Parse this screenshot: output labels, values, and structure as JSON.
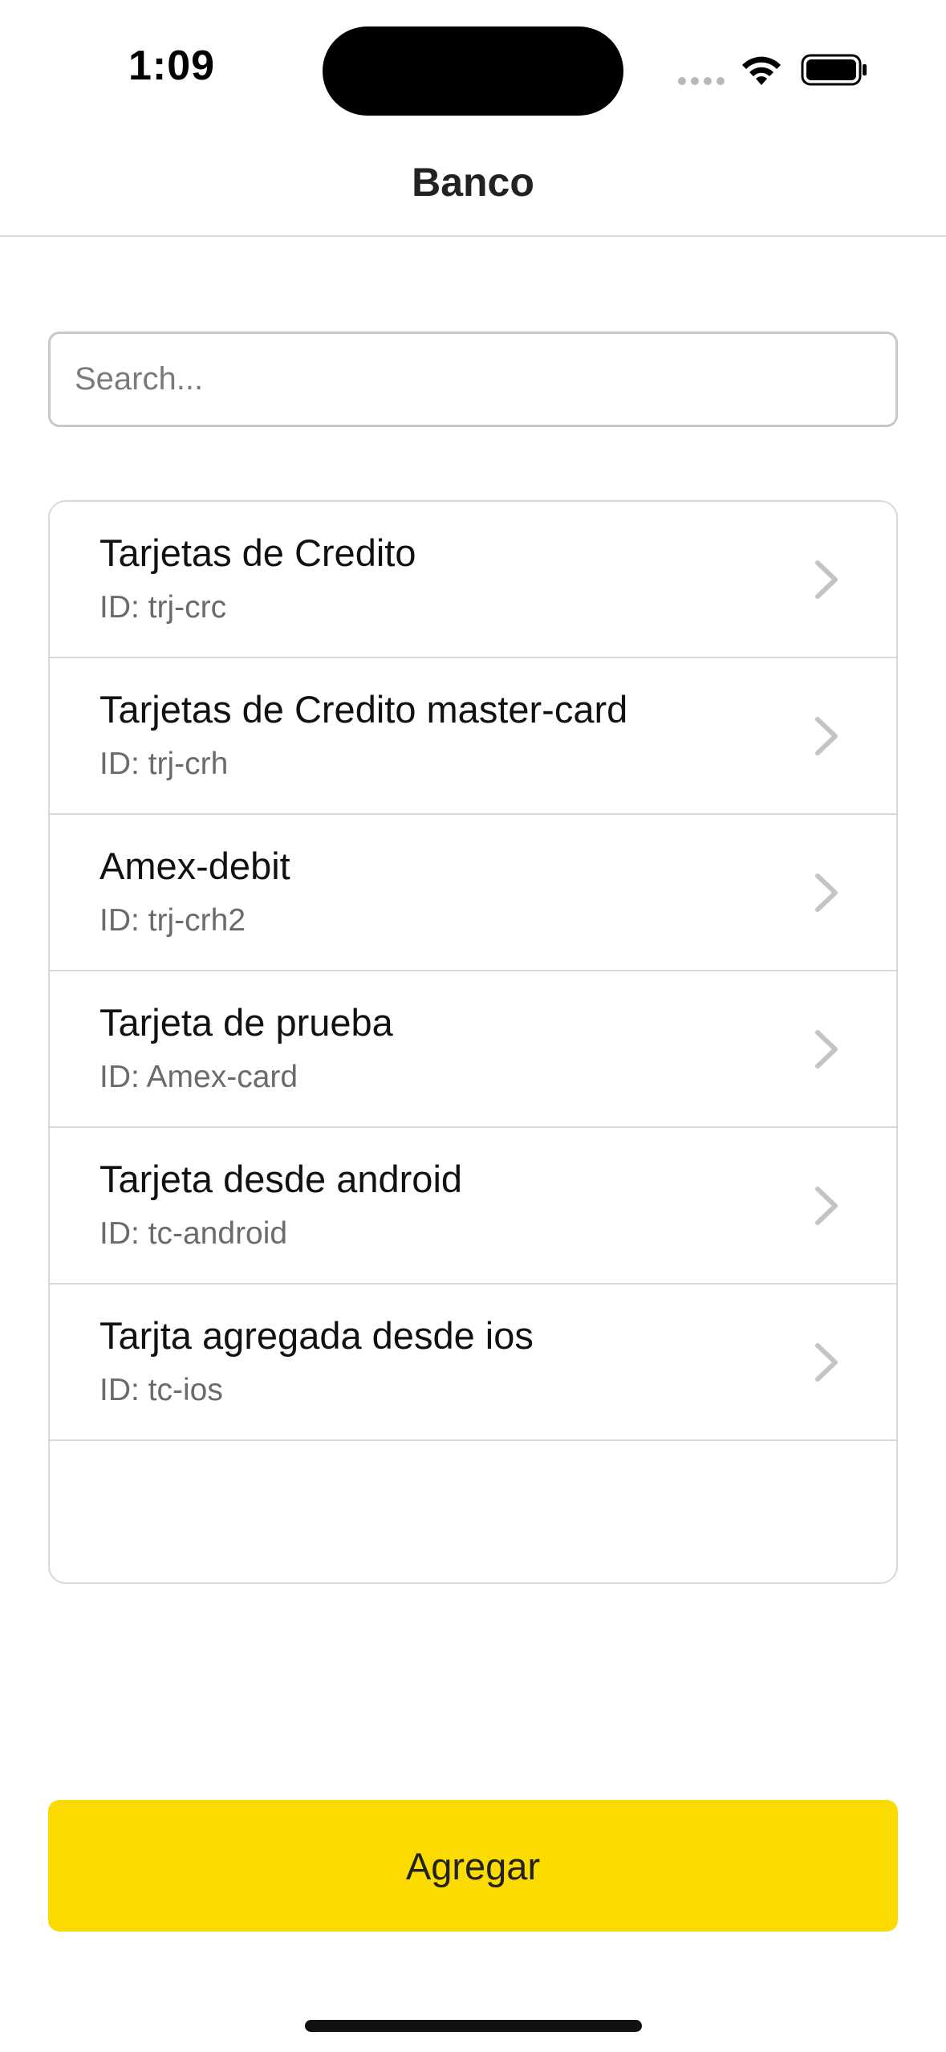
{
  "status_bar": {
    "time": "1:09",
    "icons": [
      "signal-dots-icon",
      "wifi-icon",
      "battery-icon"
    ]
  },
  "header": {
    "title": "Banco"
  },
  "search": {
    "placeholder": "Search...",
    "value": ""
  },
  "list": {
    "items": [
      {
        "title": "Tarjetas de Credito",
        "id": "ID: trj-crc"
      },
      {
        "title": "Tarjetas de Credito master-card",
        "id": "ID: trj-crh"
      },
      {
        "title": "Amex-debit",
        "id": "ID: trj-crh2"
      },
      {
        "title": "Tarjeta de prueba",
        "id": "ID: Amex-card"
      },
      {
        "title": "Tarjeta desde android",
        "id": "ID: tc-android"
      },
      {
        "title": "Tarjta agregada desde ios",
        "id": "ID: tc-ios"
      }
    ]
  },
  "actions": {
    "add_label": "Agregar"
  },
  "colors": {
    "accent": "#fcdb00",
    "divider": "#d8d8d8",
    "secondary_text": "#6b6b6b",
    "chevron": "#c4c4c4"
  }
}
